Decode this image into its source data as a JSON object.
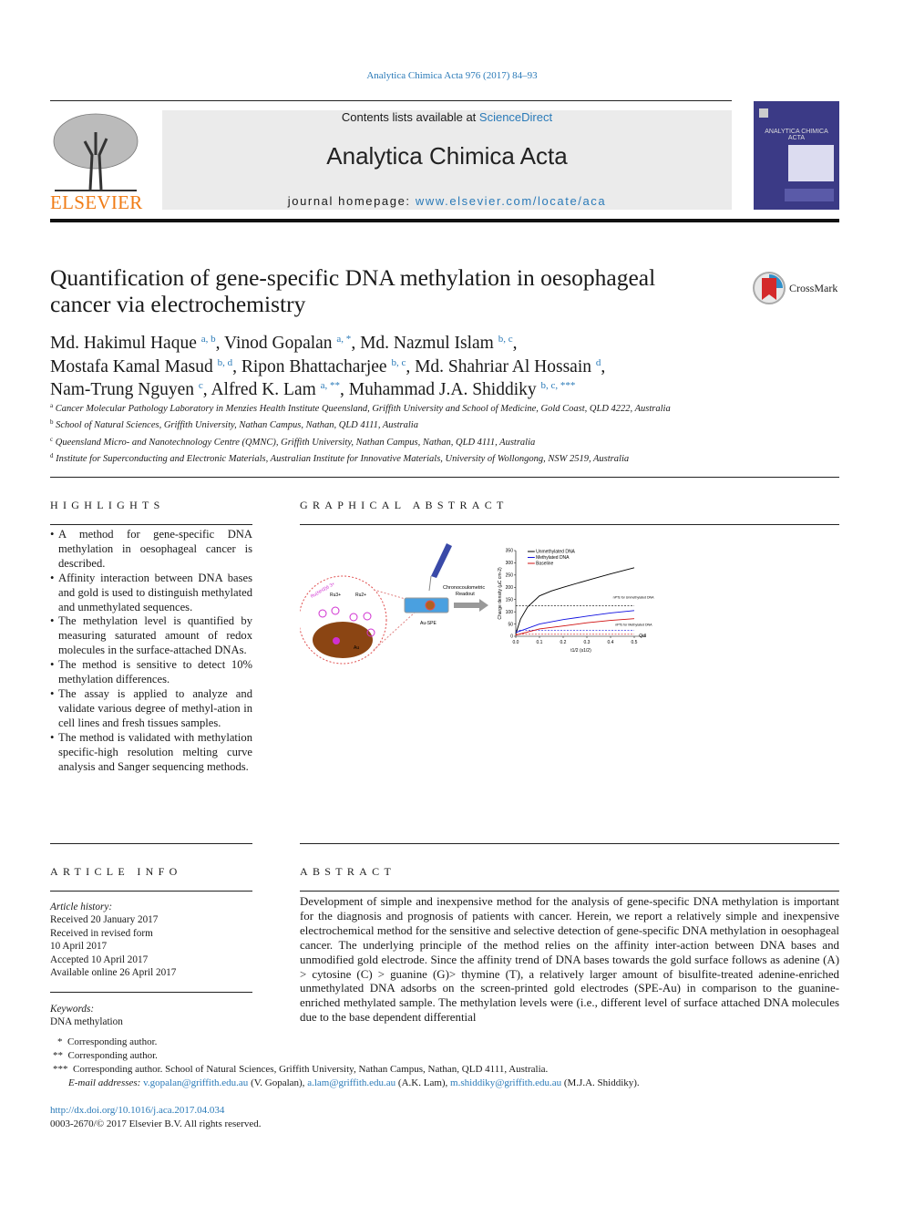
{
  "journal_line": "Analytica Chimica Acta 976 (2017) 84–93",
  "header": {
    "contents_prefix": "Contents lists available at ",
    "contents_link": "ScienceDirect",
    "journal_title": "Analytica Chimica Acta",
    "homepage_prefix": "journal homepage: ",
    "homepage_link": "www.elsevier.com/locate/aca",
    "publisher_logo": "ELSEVIER",
    "cover_title": "ANALYTICA CHIMICA ACTA"
  },
  "crossmark": "CrossMark",
  "title_line1": "Quantification of gene-specific DNA methylation in oesophageal",
  "title_line2": "cancer via electrochemistry",
  "authors": [
    {
      "name": "Md. Hakimul Haque",
      "sup": "a, b",
      "sep": ", "
    },
    {
      "name": "Vinod Gopalan",
      "sup": "a, *",
      "sep": ", "
    },
    {
      "name": "Md. Nazmul Islam",
      "sup": "b, c",
      "sep": ","
    },
    {
      "name": "Mostafa Kamal Masud",
      "sup": "b, d",
      "sep": ", "
    },
    {
      "name": "Ripon Bhattacharjee",
      "sup": "b, c",
      "sep": ", "
    },
    {
      "name": "Md. Shahriar Al Hossain",
      "sup": "d",
      "sep": ","
    },
    {
      "name": "Nam-Trung Nguyen",
      "sup": "c",
      "sep": ", "
    },
    {
      "name": "Alfred K. Lam",
      "sup": "a, **",
      "sep": ", "
    },
    {
      "name": "Muhammad J.A. Shiddiky",
      "sup": "b, c, ***",
      "sep": ""
    }
  ],
  "affiliations": [
    {
      "label": "a",
      "text": "Cancer Molecular Pathology Laboratory in Menzies Health Institute Queensland, Griffith University and School of Medicine, Gold Coast, QLD 4222, Australia"
    },
    {
      "label": "b",
      "text": "School of Natural Sciences, Griffith University, Nathan Campus, Nathan, QLD 4111, Australia"
    },
    {
      "label": "c",
      "text": "Queensland Micro- and Nanotechnology Centre (QMNC), Griffith University, Nathan Campus, Nathan, QLD 4111, Australia"
    },
    {
      "label": "d",
      "text": "Institute for Superconducting and Electronic Materials, Australian Institute for Innovative Materials, University of Wollongong, NSW 2519, Australia"
    }
  ],
  "highlights": {
    "heading": "HIGHLIGHTS",
    "items": [
      "A method for gene-specific DNA methylation in oesophageal cancer is described.",
      "Affinity interaction between DNA bases and gold is used to distinguish methylated and unmethylated sequences.",
      "The methylation level is quantified by measuring saturated amount of redox molecules in the surface-attached DNAs.",
      "The method is sensitive to detect 10% methylation differences.",
      "The assay is applied to analyze and validate various degree of methyl-ation in cell lines and fresh tissues samples.",
      "The method is validated with methylation specific-high resolution melting curve analysis and Sanger sequencing methods."
    ]
  },
  "graphical_abstract": {
    "heading": "GRAPHICAL ABSTRACT",
    "labels": {
      "redox": "Ru(NH3)6 3+",
      "ru1": "Ru3+",
      "ru2": "Ru2+",
      "au": "Au",
      "electrode": "Au-SPE",
      "readout_line1": "Chronocoulometric",
      "readout_line2": "Readout",
      "qdl": "Qdl",
      "annot_unmeth": "nPTs for Unmethylated DNA",
      "annot_meth": "nPTs for Methylated DNA"
    },
    "colors": {
      "unmethylated": "#000000",
      "methylated": "#1010e0",
      "baseline": "#d01010",
      "electrode_surface": "#8b4513",
      "circle": "#e05050"
    }
  },
  "chart_data": {
    "type": "line",
    "xlabel": "t1/2 (s1/2)",
    "ylabel": "Charge density (µC cm-2)",
    "xlim": [
      0,
      0.55
    ],
    "ylim": [
      0,
      350
    ],
    "xticks": [
      "0.0",
      "0.1",
      "0.2",
      "0.3",
      "0.4",
      "0.5"
    ],
    "yticks": [
      "0",
      "50",
      "100",
      "150",
      "200",
      "250",
      "300",
      "350"
    ],
    "legend": "top-left",
    "series": [
      {
        "name": "Unmethylated DNA",
        "color": "#000000",
        "x": [
          0,
          0.02,
          0.05,
          0.1,
          0.15,
          0.2,
          0.3,
          0.4,
          0.5
        ],
        "y": [
          10,
          70,
          120,
          165,
          185,
          200,
          228,
          255,
          280
        ]
      },
      {
        "name": "Methylated DNA",
        "color": "#1010e0",
        "x": [
          0,
          0.1,
          0.2,
          0.3,
          0.4,
          0.5
        ],
        "y": [
          15,
          50,
          68,
          82,
          95,
          105
        ]
      },
      {
        "name": "Baseline",
        "color": "#d01010",
        "x": [
          0,
          0.1,
          0.2,
          0.3,
          0.4,
          0.5
        ],
        "y": [
          5,
          30,
          42,
          55,
          65,
          72
        ]
      }
    ],
    "dashed_levels": [
      {
        "color": "#000000",
        "y": 125
      },
      {
        "color": "#1010e0",
        "y": 25
      },
      {
        "color": "#d01010",
        "y": 8
      }
    ]
  },
  "article_info": {
    "heading": "ARTICLE INFO",
    "history_label": "Article history:",
    "history": [
      "Received 20 January 2017",
      "Received in revised form",
      "10 April 2017",
      "Accepted 10 April 2017",
      "Available online 26 April 2017"
    ],
    "keywords_label": "Keywords:",
    "keywords": [
      "DNA methylation"
    ]
  },
  "abstract": {
    "heading": "ABSTRACT",
    "text": "Development of simple and inexpensive method for the analysis of gene-specific DNA methylation is important for the diagnosis and prognosis of patients with cancer. Herein, we report a relatively simple and inexpensive electrochemical method for the sensitive and selective detection of gene-specific DNA methylation in oesophageal cancer. The underlying principle of the method relies on the affinity inter-action between DNA bases and unmodified gold electrode. Since the affinity trend of DNA bases towards the gold surface follows as adenine (A) > cytosine (C) > guanine (G)> thymine (T), a relatively larger amount of bisulfite-treated adenine-enriched unmethylated DNA adsorbs on the screen-printed gold electrodes (SPE-Au) in comparison to the guanine-enriched methylated sample. The methylation levels were (i.e., different level of surface attached DNA molecules due to the base dependent differential"
  },
  "footnotes": {
    "star1_mark": "*",
    "star1": "Corresponding author.",
    "star2_mark": "**",
    "star2": "Corresponding author.",
    "star3_mark": "***",
    "star3": "Corresponding author. School of Natural Sciences, Griffith University, Nathan Campus, Nathan, QLD 4111, Australia.",
    "email_label": "E-mail addresses:",
    "emails": [
      {
        "address": "v.gopalan@griffith.edu.au",
        "name": " (V. Gopalan), "
      },
      {
        "address": "a.lam@griffith.edu.au",
        "name": " (A.K. Lam), "
      },
      {
        "address": "m.shiddiky@griffith.edu.au",
        "name": " (M.J.A. Shiddiky)."
      }
    ]
  },
  "doi": "http://dx.doi.org/10.1016/j.aca.2017.04.034",
  "copyright": "0003-2670/© 2017 Elsevier B.V. All rights reserved.",
  "colors": {
    "link": "#2a7ab8",
    "elsevier_orange": "#f07c16",
    "header_box": "#ebebeb",
    "cover": "#3b3a86"
  }
}
